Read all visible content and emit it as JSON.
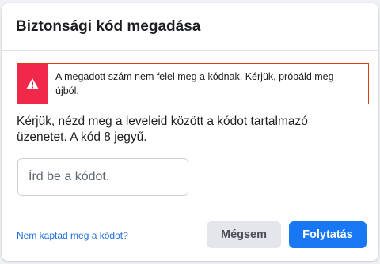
{
  "dialog": {
    "title": "Biztonsági kód megadása",
    "error_message": "A megadott szám nem felel meg a kódnak. Kérjük, próbáld meg újból.",
    "instruction": "Kérjük, nézd meg a leveleid között a kódot tartalmazó üzenetet. A kód 8 jegyű.",
    "code_input": {
      "value": "",
      "placeholder": "Írd be a kódot."
    },
    "resend_link": "Nem kaptad meg a kódot?",
    "cancel_label": "Mégsem",
    "continue_label": "Folytatás"
  },
  "icons": {
    "error": "warning-triangle-icon"
  },
  "colors": {
    "error_border": "#dd3c10",
    "error_icon_bg": "#f02849",
    "primary": "#1877f2",
    "link": "#216fdb",
    "secondary_button": "#e4e6eb"
  }
}
